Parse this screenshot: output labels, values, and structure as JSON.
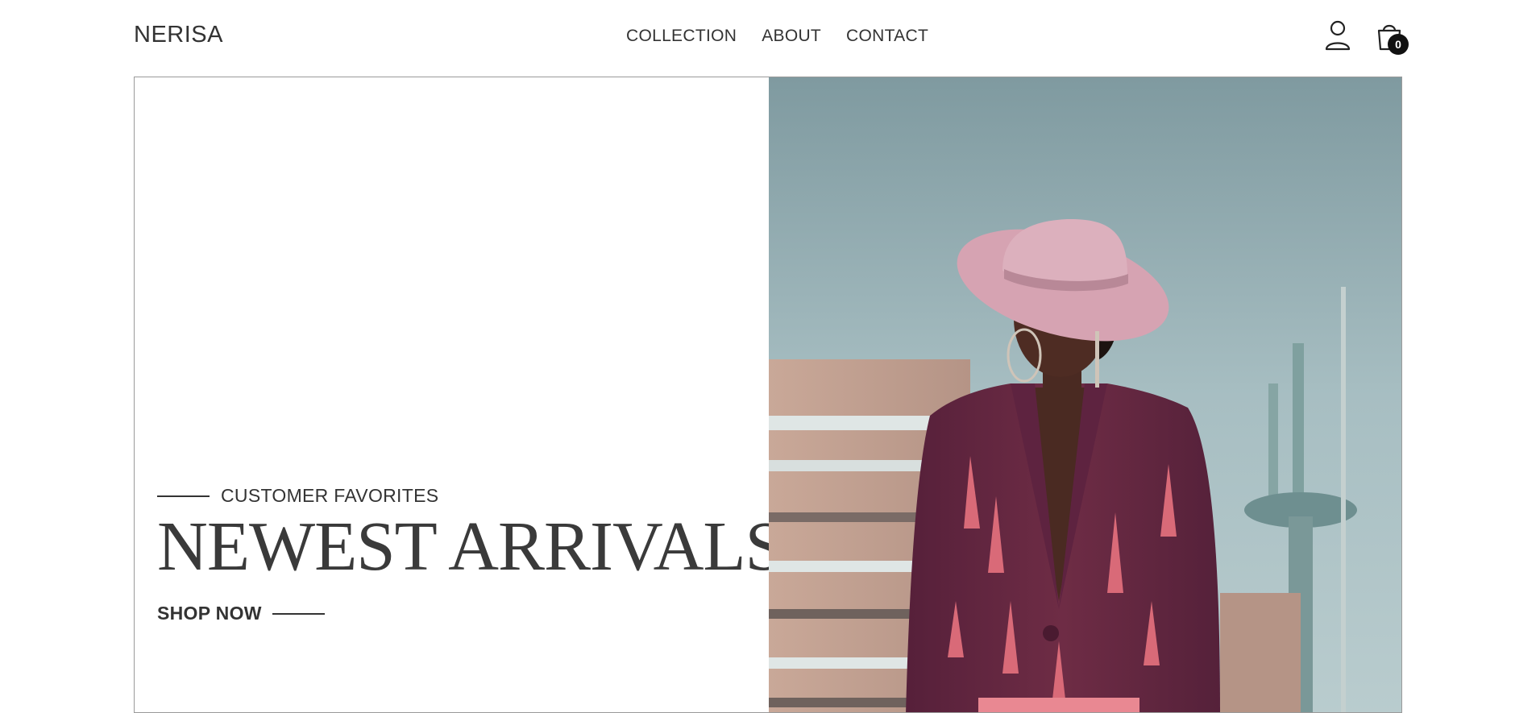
{
  "header": {
    "logo": "NERISA",
    "nav": [
      "COLLECTION",
      "ABOUT",
      "CONTACT"
    ],
    "cart_count": "0",
    "icons": {
      "account": "user-icon",
      "cart": "shopping-bag-icon"
    }
  },
  "hero": {
    "eyebrow": "CUSTOMER FAVORITES",
    "headline": "NEWEST ARRIVALS",
    "cta": "SHOP NOW"
  },
  "colors": {
    "text": "#333333",
    "badge": "#111111",
    "jacket": "#6a2a3f",
    "hat": "#d8a8b4",
    "sky": "#9fb4b8"
  }
}
